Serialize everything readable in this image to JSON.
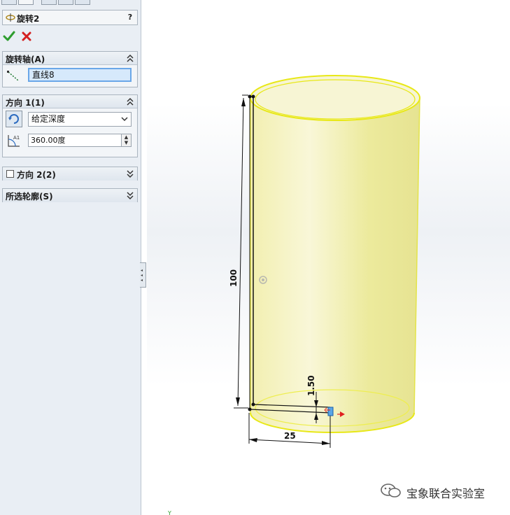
{
  "feature": {
    "title": "旋转2",
    "help_label": "?"
  },
  "actions": {
    "ok_label": "确定",
    "cancel_label": "取消"
  },
  "sections": {
    "axis": {
      "title": "旋转轴(A)",
      "value": "直线8"
    },
    "direction1": {
      "title": "方向 1(1)",
      "end_condition": "给定深度",
      "angle": "360.00度"
    },
    "direction2": {
      "title": "方向 2(2)"
    },
    "profiles": {
      "title": "所选轮廓(S)"
    }
  },
  "dimensions": {
    "height": "100",
    "thickness": "1.50",
    "radius": "25"
  },
  "watermark": {
    "text": "宝象联合实验室"
  },
  "colors": {
    "body_fill": "#f3f1b6",
    "body_edge": "#e8e817",
    "ok_green": "#2e9d2e",
    "cancel_red": "#d42020",
    "selection_blue": "#6aa7e8"
  }
}
